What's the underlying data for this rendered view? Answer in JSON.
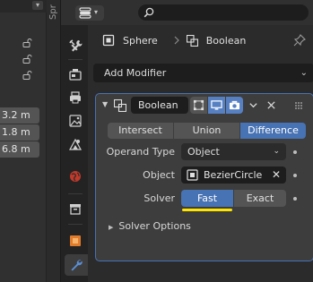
{
  "outliner": {
    "values": [
      "3.2 m",
      "1.8 m",
      "6.8 m"
    ]
  },
  "sidebar_tab_label": "Spr",
  "header": {
    "editor_type_icon": "wrench-screwdriver-icon",
    "search_placeholder": ""
  },
  "breadcrumb": {
    "object_name": "Sphere",
    "modifier_name": "Boolean"
  },
  "add_modifier": {
    "label": "Add Modifier"
  },
  "modifier": {
    "name": "Boolean",
    "operations": [
      "Intersect",
      "Union",
      "Difference"
    ],
    "active_operation": "Difference",
    "operand_type": {
      "label": "Operand Type",
      "value": "Object"
    },
    "object": {
      "label": "Object",
      "value": "BezierCircle"
    },
    "solver": {
      "label": "Solver",
      "options": [
        "Fast",
        "Exact"
      ],
      "active": "Fast"
    },
    "solver_options_label": "Solver Options"
  },
  "colors": {
    "accent": "#4772b3",
    "highlight": "#ffe600",
    "panel": "#3d3d3d",
    "background": "#2b2b2b"
  }
}
